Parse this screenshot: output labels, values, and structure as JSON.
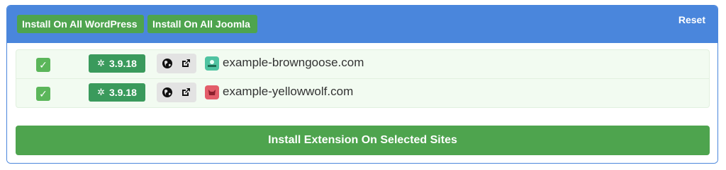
{
  "header": {
    "install_all_wordpress": "Install On All WordPress",
    "install_all_joomla": "Install On All Joomla",
    "reset": "Reset"
  },
  "sites": [
    {
      "checked": true,
      "version": "3.9.18",
      "domain": "example-browngoose.com",
      "icon_color": "#4fc3a1"
    },
    {
      "checked": true,
      "version": "3.9.18",
      "domain": "example-yellowwolf.com",
      "icon_color": "#e35d6a"
    }
  ],
  "footer": {
    "install_selected": "Install Extension On Selected Sites"
  },
  "colors": {
    "header_bg": "#4a86dc",
    "button_green": "#4ea44e",
    "version_badge": "#3a9a5c",
    "rows_bg": "#f2fbf1"
  }
}
